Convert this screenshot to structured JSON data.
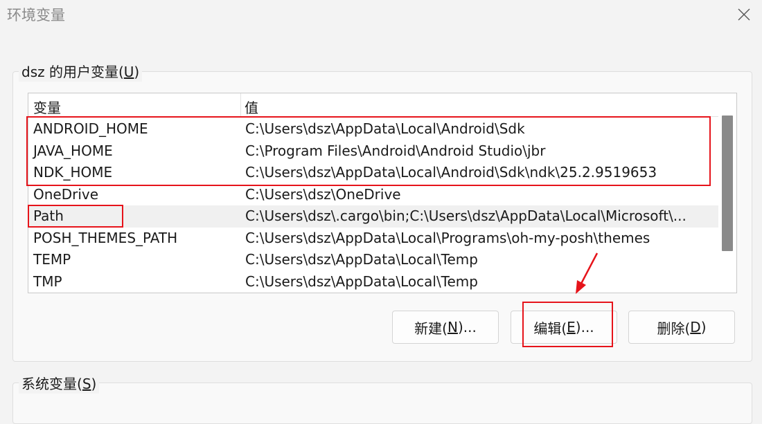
{
  "window": {
    "title": "环境变量"
  },
  "icons": {
    "close": "close-icon"
  },
  "user_group": {
    "label_prefix": "dsz 的用户变量(",
    "label_access": "U",
    "label_suffix": ")",
    "columns": {
      "name": "变量",
      "value": "值"
    },
    "rows": [
      {
        "name": "ANDROID_HOME",
        "value": "C:\\Users\\dsz\\AppData\\Local\\Android\\Sdk"
      },
      {
        "name": "JAVA_HOME",
        "value": "C:\\Program Files\\Android\\Android Studio\\jbr"
      },
      {
        "name": "NDK_HOME",
        "value": "C:\\Users\\dsz\\AppData\\Local\\Android\\Sdk\\ndk\\25.2.9519653"
      },
      {
        "name": "OneDrive",
        "value": "C:\\Users\\dsz\\OneDrive"
      },
      {
        "name": "Path",
        "value": "C:\\Users\\dsz\\.cargo\\bin;C:\\Users\\dsz\\AppData\\Local\\Microsoft\\..."
      },
      {
        "name": "POSH_THEMES_PATH",
        "value": "C:\\Users\\dsz\\AppData\\Local\\Programs\\oh-my-posh\\themes"
      },
      {
        "name": "TEMP",
        "value": "C:\\Users\\dsz\\AppData\\Local\\Temp"
      },
      {
        "name": "TMP",
        "value": "C:\\Users\\dsz\\AppData\\Local\\Temp"
      }
    ],
    "buttons": {
      "new": {
        "prefix": "新建(",
        "access": "N",
        "suffix": ")..."
      },
      "edit": {
        "prefix": "编辑(",
        "access": "E",
        "suffix": ")..."
      },
      "delete": {
        "prefix": "删除(",
        "access": "D",
        "suffix": ")"
      }
    }
  },
  "system_group": {
    "label_prefix": "系统变量(",
    "label_access": "S",
    "label_suffix": ")"
  },
  "colors": {
    "annotation": "#e6131a",
    "selected_row": "#f0f0f0",
    "scroll_thumb": "#8a8a8a"
  }
}
